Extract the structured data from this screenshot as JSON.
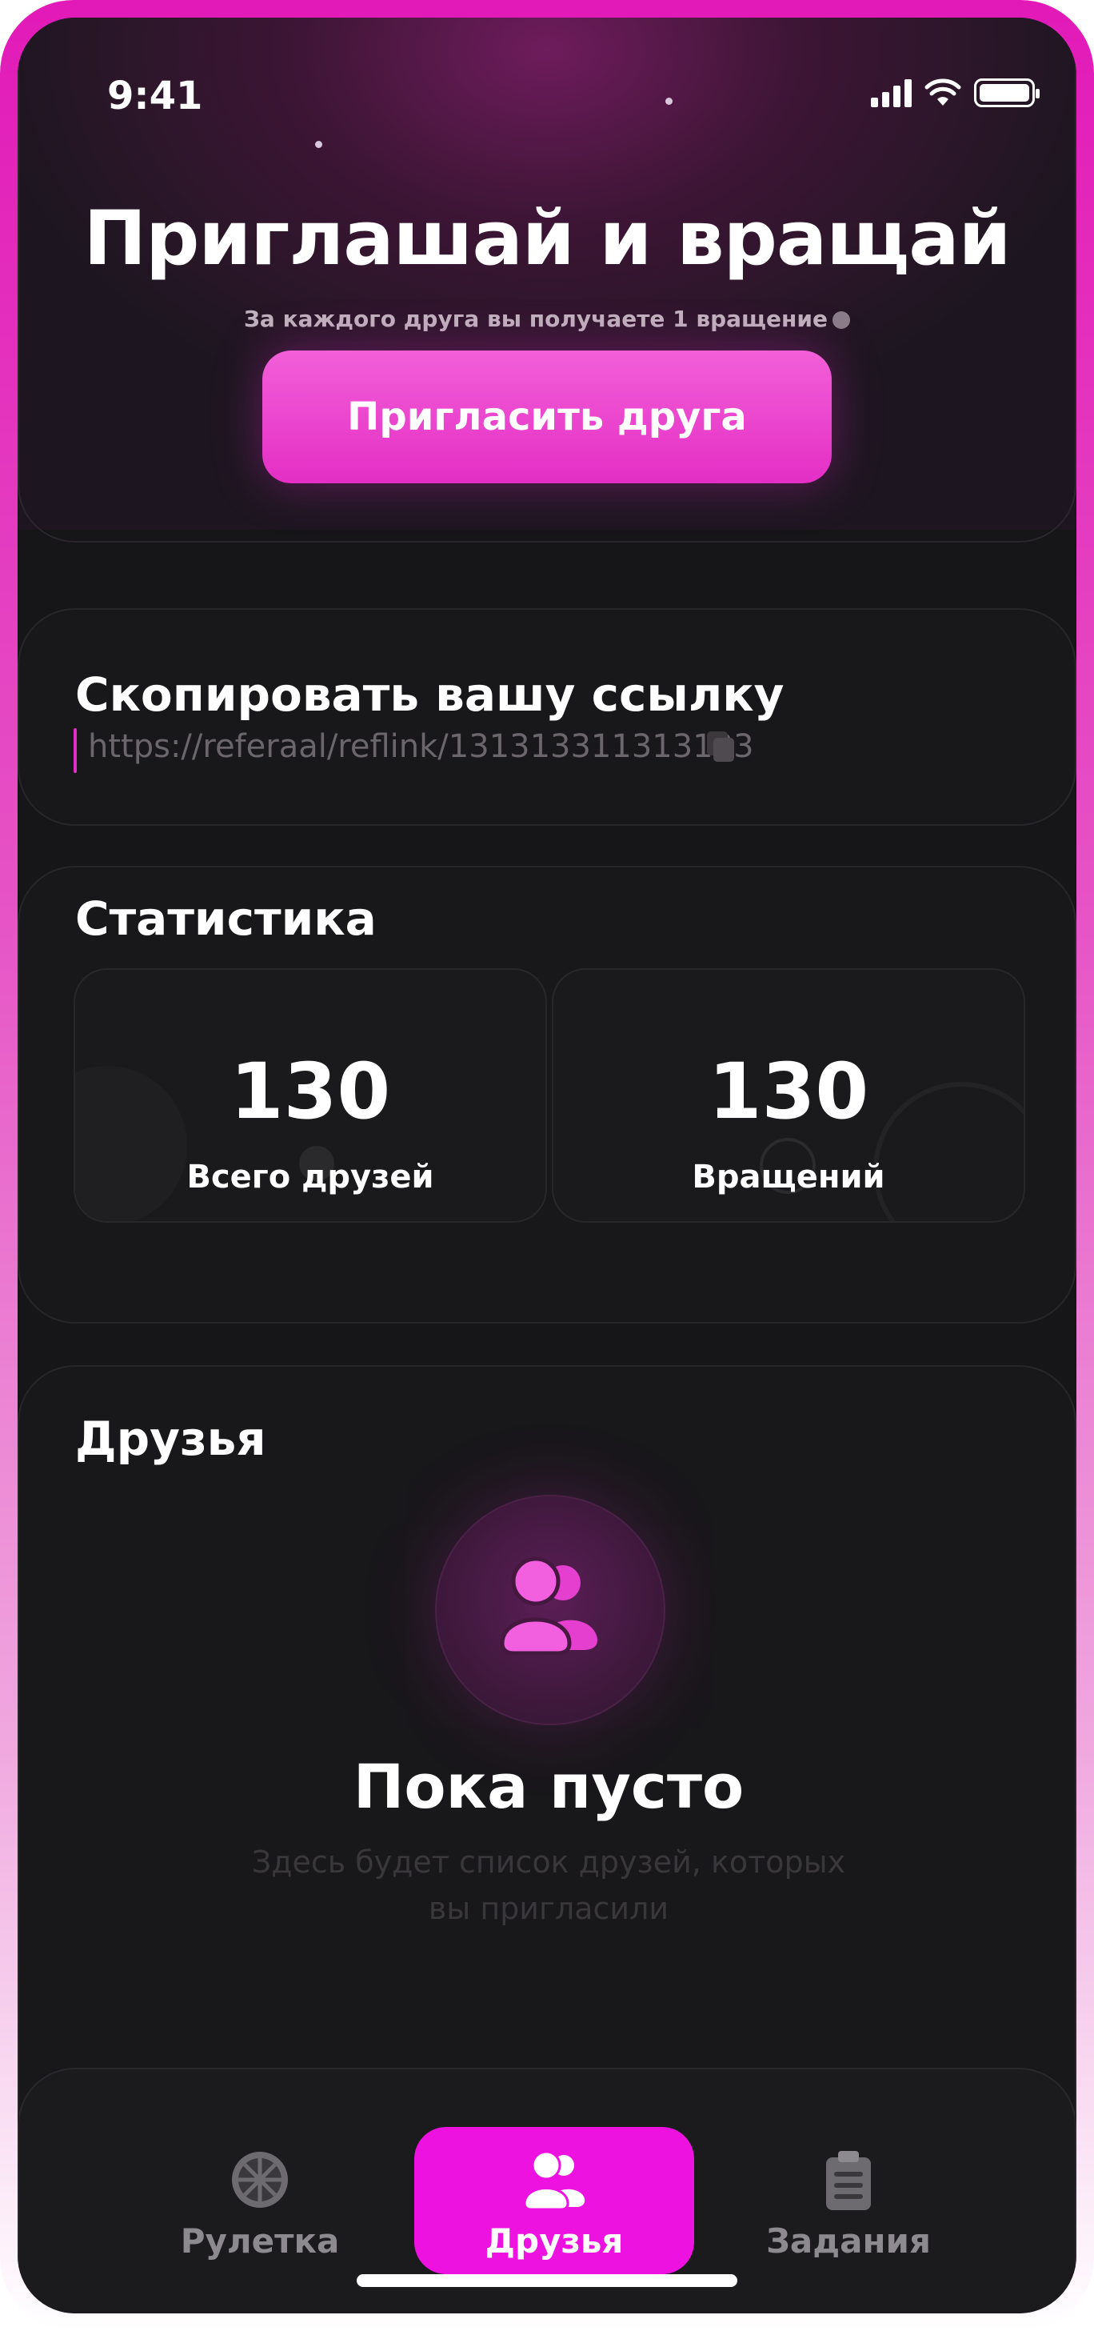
{
  "status_bar": {
    "time": "9:41"
  },
  "hero": {
    "title": "Приглашай и вращай",
    "subtitle": "За каждого друга вы получаете 1 вращение",
    "invite_button": "Пригласить друга"
  },
  "link_card": {
    "title": "Скопировать вашу ссылку",
    "link": "https://referaal/reflink/131313311313133"
  },
  "stats": {
    "title": "Статистика",
    "items": [
      {
        "value": "130",
        "label": "Всего друзей"
      },
      {
        "value": "130",
        "label": "Вращений"
      }
    ]
  },
  "friends": {
    "title": "Друзья",
    "empty_title": "Пока пусто",
    "empty_desc": "Здесь будет список друзей, которых вы пригласили"
  },
  "tabbar": {
    "items": [
      {
        "label": "Рулетка",
        "icon": "roulette-wheel-icon",
        "active": false
      },
      {
        "label": "Друзья",
        "icon": "friends-icon",
        "active": true
      },
      {
        "label": "Задания",
        "icon": "tasks-clipboard-icon",
        "active": false
      }
    ]
  },
  "colors": {
    "accent": "#e42fc5",
    "background": "#161518",
    "frame": "#e21ab8"
  }
}
